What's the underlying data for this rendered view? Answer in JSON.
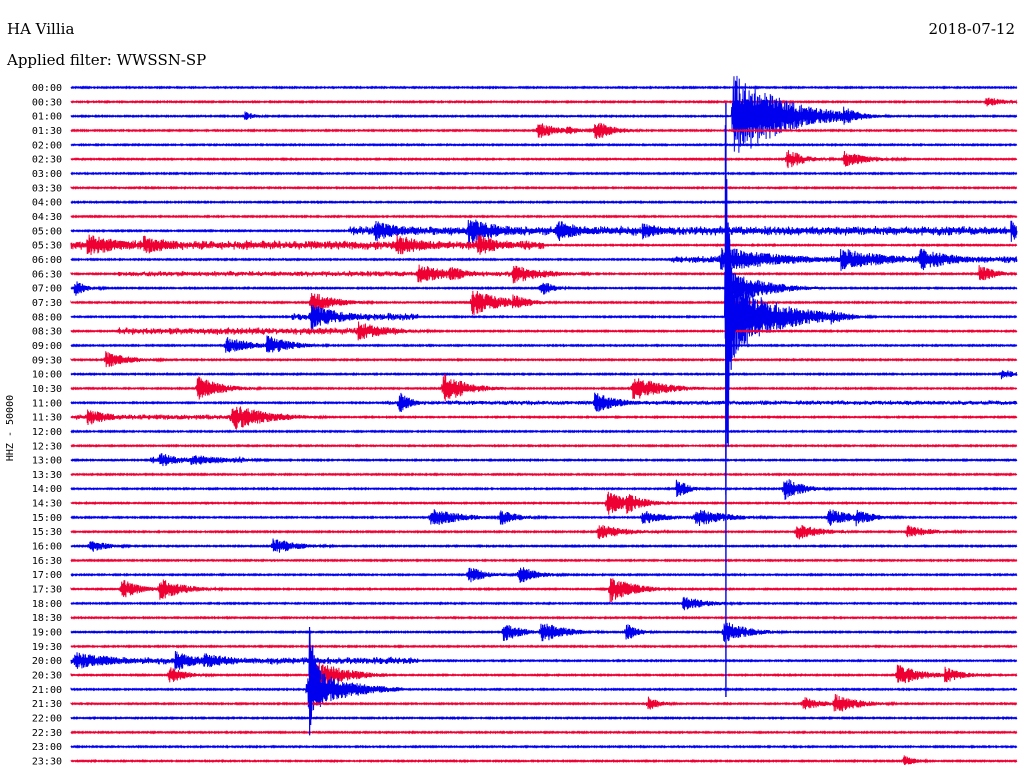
{
  "header": {
    "station": "HA Villia",
    "date": "2018-07-12",
    "filter_label": "Applied filter:",
    "filter_value": "WWSSN-SP"
  },
  "chart_data": {
    "type": "line",
    "title": "",
    "ylabel": "HHZ - 50000",
    "rows": [
      "00:00",
      "00:30",
      "01:00",
      "01:30",
      "02:00",
      "02:30",
      "03:00",
      "03:30",
      "04:00",
      "04:30",
      "05:00",
      "05:30",
      "06:00",
      "06:30",
      "07:00",
      "07:30",
      "08:00",
      "08:30",
      "09:00",
      "09:30",
      "10:00",
      "10:30",
      "11:00",
      "11:30",
      "12:00",
      "12:30",
      "13:00",
      "13:30",
      "14:00",
      "14:30",
      "15:00",
      "15:30",
      "16:00",
      "16:30",
      "17:00",
      "17:30",
      "18:00",
      "18:30",
      "19:00",
      "19:30",
      "20:00",
      "20:30",
      "21:00",
      "21:30",
      "22:00",
      "22:30",
      "23:00",
      "23:30"
    ],
    "minutes_per_row": 30,
    "series_colors": [
      "#0000ee",
      "#ee0033"
    ],
    "events": [
      {
        "row": 1,
        "t": 29.0,
        "amp": 6,
        "dur": 1.5
      },
      {
        "row": 2,
        "t": 5.5,
        "amp": 5,
        "dur": 1
      },
      {
        "row": 2,
        "t": 21.0,
        "amp": 48,
        "dur": 4
      },
      {
        "row": 2,
        "t": 24.5,
        "amp": 10,
        "dur": 1.5
      },
      {
        "row": 3,
        "t": 14.8,
        "amp": 10,
        "dur": 1.5
      },
      {
        "row": 3,
        "t": 15.7,
        "amp": 6,
        "dur": 1
      },
      {
        "row": 3,
        "t": 16.6,
        "amp": 12,
        "dur": 1.5
      },
      {
        "row": 5,
        "t": 22.7,
        "amp": 11,
        "dur": 1.5
      },
      {
        "row": 5,
        "t": 24.5,
        "amp": 9,
        "dur": 2
      },
      {
        "row": 10,
        "t": 9.6,
        "amp": 12,
        "dur": 2.5
      },
      {
        "row": 10,
        "t": 12.6,
        "amp": 14,
        "dur": 3
      },
      {
        "row": 10,
        "t": 15.4,
        "amp": 13,
        "dur": 2
      },
      {
        "row": 10,
        "t": 18.1,
        "amp": 9,
        "dur": 2
      },
      {
        "row": 10,
        "t": 29.8,
        "amp": 12,
        "dur": 1.5
      },
      {
        "row": 11,
        "t": 0.5,
        "amp": 12,
        "dur": 3
      },
      {
        "row": 11,
        "t": 2.3,
        "amp": 10,
        "dur": 3
      },
      {
        "row": 11,
        "t": 10.3,
        "amp": 11,
        "dur": 3
      },
      {
        "row": 11,
        "t": 12.9,
        "amp": 12,
        "dur": 2
      },
      {
        "row": 12,
        "t": 20.6,
        "amp": 14,
        "dur": 5
      },
      {
        "row": 12,
        "t": 24.4,
        "amp": 12,
        "dur": 4
      },
      {
        "row": 12,
        "t": 26.9,
        "amp": 12,
        "dur": 3
      },
      {
        "row": 13,
        "t": 11.0,
        "amp": 10,
        "dur": 3
      },
      {
        "row": 13,
        "t": 12.0,
        "amp": 9,
        "dur": 1.5
      },
      {
        "row": 13,
        "t": 14.0,
        "amp": 11,
        "dur": 2.5
      },
      {
        "row": 13,
        "t": 28.8,
        "amp": 9,
        "dur": 1.5
      },
      {
        "row": 14,
        "t": 0.1,
        "amp": 9,
        "dur": 1
      },
      {
        "row": 14,
        "t": 14.9,
        "amp": 9,
        "dur": 1
      },
      {
        "row": 14,
        "t": 20.9,
        "amp": 18,
        "dur": 3
      },
      {
        "row": 15,
        "t": 7.6,
        "amp": 12,
        "dur": 2
      },
      {
        "row": 15,
        "t": 12.7,
        "amp": 14,
        "dur": 2.5
      },
      {
        "row": 15,
        "t": 14.0,
        "amp": 9,
        "dur": 1.5
      },
      {
        "row": 16,
        "t": 7.6,
        "amp": 14,
        "dur": 2.5
      },
      {
        "row": 16,
        "t": 20.8,
        "amp": 40,
        "dur": 4
      },
      {
        "row": 16,
        "t": 24.1,
        "amp": 8,
        "dur": 1.5
      },
      {
        "row": 17,
        "t": 9.1,
        "amp": 10,
        "dur": 2.5
      },
      {
        "row": 18,
        "t": 4.9,
        "amp": 10,
        "dur": 2
      },
      {
        "row": 18,
        "t": 6.2,
        "amp": 11,
        "dur": 2
      },
      {
        "row": 19,
        "t": 1.1,
        "amp": 9,
        "dur": 2
      },
      {
        "row": 20,
        "t": 29.5,
        "amp": 7,
        "dur": 1
      },
      {
        "row": 21,
        "t": 4.0,
        "amp": 13,
        "dur": 2
      },
      {
        "row": 21,
        "t": 11.8,
        "amp": 16,
        "dur": 2
      },
      {
        "row": 21,
        "t": 17.8,
        "amp": 14,
        "dur": 2.5
      },
      {
        "row": 22,
        "t": 10.4,
        "amp": 12,
        "dur": 1
      },
      {
        "row": 22,
        "t": 16.6,
        "amp": 11,
        "dur": 2
      },
      {
        "row": 23,
        "t": 0.5,
        "amp": 9,
        "dur": 2
      },
      {
        "row": 23,
        "t": 5.1,
        "amp": 14,
        "dur": 3
      },
      {
        "row": 26,
        "t": 2.8,
        "amp": 9,
        "dur": 1.5
      },
      {
        "row": 26,
        "t": 3.8,
        "amp": 6,
        "dur": 3
      },
      {
        "row": 28,
        "t": 19.2,
        "amp": 11,
        "dur": 1
      },
      {
        "row": 28,
        "t": 22.6,
        "amp": 13,
        "dur": 1.5
      },
      {
        "row": 29,
        "t": 17.0,
        "amp": 14,
        "dur": 1.5
      },
      {
        "row": 29,
        "t": 17.6,
        "amp": 12,
        "dur": 1.5
      },
      {
        "row": 30,
        "t": 11.4,
        "amp": 10,
        "dur": 2.5
      },
      {
        "row": 30,
        "t": 13.6,
        "amp": 9,
        "dur": 1.5
      },
      {
        "row": 30,
        "t": 18.1,
        "amp": 8,
        "dur": 2
      },
      {
        "row": 30,
        "t": 19.8,
        "amp": 10,
        "dur": 2.5
      },
      {
        "row": 30,
        "t": 24.0,
        "amp": 10,
        "dur": 2
      },
      {
        "row": 30,
        "t": 24.9,
        "amp": 9,
        "dur": 1.5
      },
      {
        "row": 31,
        "t": 16.7,
        "amp": 8,
        "dur": 2.5
      },
      {
        "row": 31,
        "t": 23.0,
        "amp": 9,
        "dur": 2
      },
      {
        "row": 31,
        "t": 26.5,
        "amp": 7,
        "dur": 2
      },
      {
        "row": 32,
        "t": 0.6,
        "amp": 7,
        "dur": 1.5
      },
      {
        "row": 32,
        "t": 6.4,
        "amp": 9,
        "dur": 2
      },
      {
        "row": 34,
        "t": 12.6,
        "amp": 9,
        "dur": 1.5
      },
      {
        "row": 34,
        "t": 14.2,
        "amp": 10,
        "dur": 1.5
      },
      {
        "row": 35,
        "t": 1.6,
        "amp": 11,
        "dur": 1.5
      },
      {
        "row": 35,
        "t": 2.8,
        "amp": 12,
        "dur": 2
      },
      {
        "row": 35,
        "t": 17.1,
        "amp": 14,
        "dur": 2
      },
      {
        "row": 36,
        "t": 19.4,
        "amp": 8,
        "dur": 2
      },
      {
        "row": 38,
        "t": 13.7,
        "amp": 11,
        "dur": 1.5
      },
      {
        "row": 38,
        "t": 14.9,
        "amp": 12,
        "dur": 2
      },
      {
        "row": 38,
        "t": 17.6,
        "amp": 10,
        "dur": 1
      },
      {
        "row": 38,
        "t": 20.7,
        "amp": 12,
        "dur": 2
      },
      {
        "row": 40,
        "t": 0.1,
        "amp": 9,
        "dur": 4
      },
      {
        "row": 40,
        "t": 3.3,
        "amp": 11,
        "dur": 2
      },
      {
        "row": 40,
        "t": 4.2,
        "amp": 8,
        "dur": 3
      },
      {
        "row": 41,
        "t": 3.1,
        "amp": 9,
        "dur": 1.5
      },
      {
        "row": 41,
        "t": 26.2,
        "amp": 12,
        "dur": 2
      },
      {
        "row": 41,
        "t": 27.7,
        "amp": 9,
        "dur": 1.5
      },
      {
        "row": 42,
        "t": 7.5,
        "amp": 26,
        "dur": 3
      },
      {
        "row": 43,
        "t": 18.3,
        "amp": 8,
        "dur": 1
      },
      {
        "row": 43,
        "t": 23.2,
        "amp": 8,
        "dur": 1.5
      },
      {
        "row": 43,
        "t": 24.2,
        "amp": 11,
        "dur": 2
      },
      {
        "row": 47,
        "t": 26.4,
        "amp": 6,
        "dur": 1
      }
    ],
    "noisy_segments": [
      {
        "row": 10,
        "t0": 8.8,
        "t1": 30.0,
        "amp": 5
      },
      {
        "row": 11,
        "t0": 0.0,
        "t1": 15.0,
        "amp": 5
      },
      {
        "row": 12,
        "t0": 19.0,
        "t1": 30.0,
        "amp": 4
      },
      {
        "row": 13,
        "t0": 1.5,
        "t1": 14.5,
        "amp": 3
      },
      {
        "row": 16,
        "t0": 7.0,
        "t1": 11.0,
        "amp": 4
      },
      {
        "row": 17,
        "t0": 1.5,
        "t1": 10.5,
        "amp": 4
      },
      {
        "row": 22,
        "t0": 10.0,
        "t1": 30.0,
        "amp": 2.5
      },
      {
        "row": 23,
        "t0": 0.0,
        "t1": 7.0,
        "amp": 3
      },
      {
        "row": 26,
        "t0": 2.5,
        "t1": 5.5,
        "amp": 4
      },
      {
        "row": 40,
        "t0": 0.0,
        "t1": 11.0,
        "amp": 4
      }
    ],
    "main_quake": {
      "row": 16,
      "t": 20.75,
      "amp_peak": 250,
      "t_end": 22.6
    },
    "big_event": {
      "row": 41,
      "t": 7.55,
      "amp": 70,
      "dur": 2.5
    }
  }
}
